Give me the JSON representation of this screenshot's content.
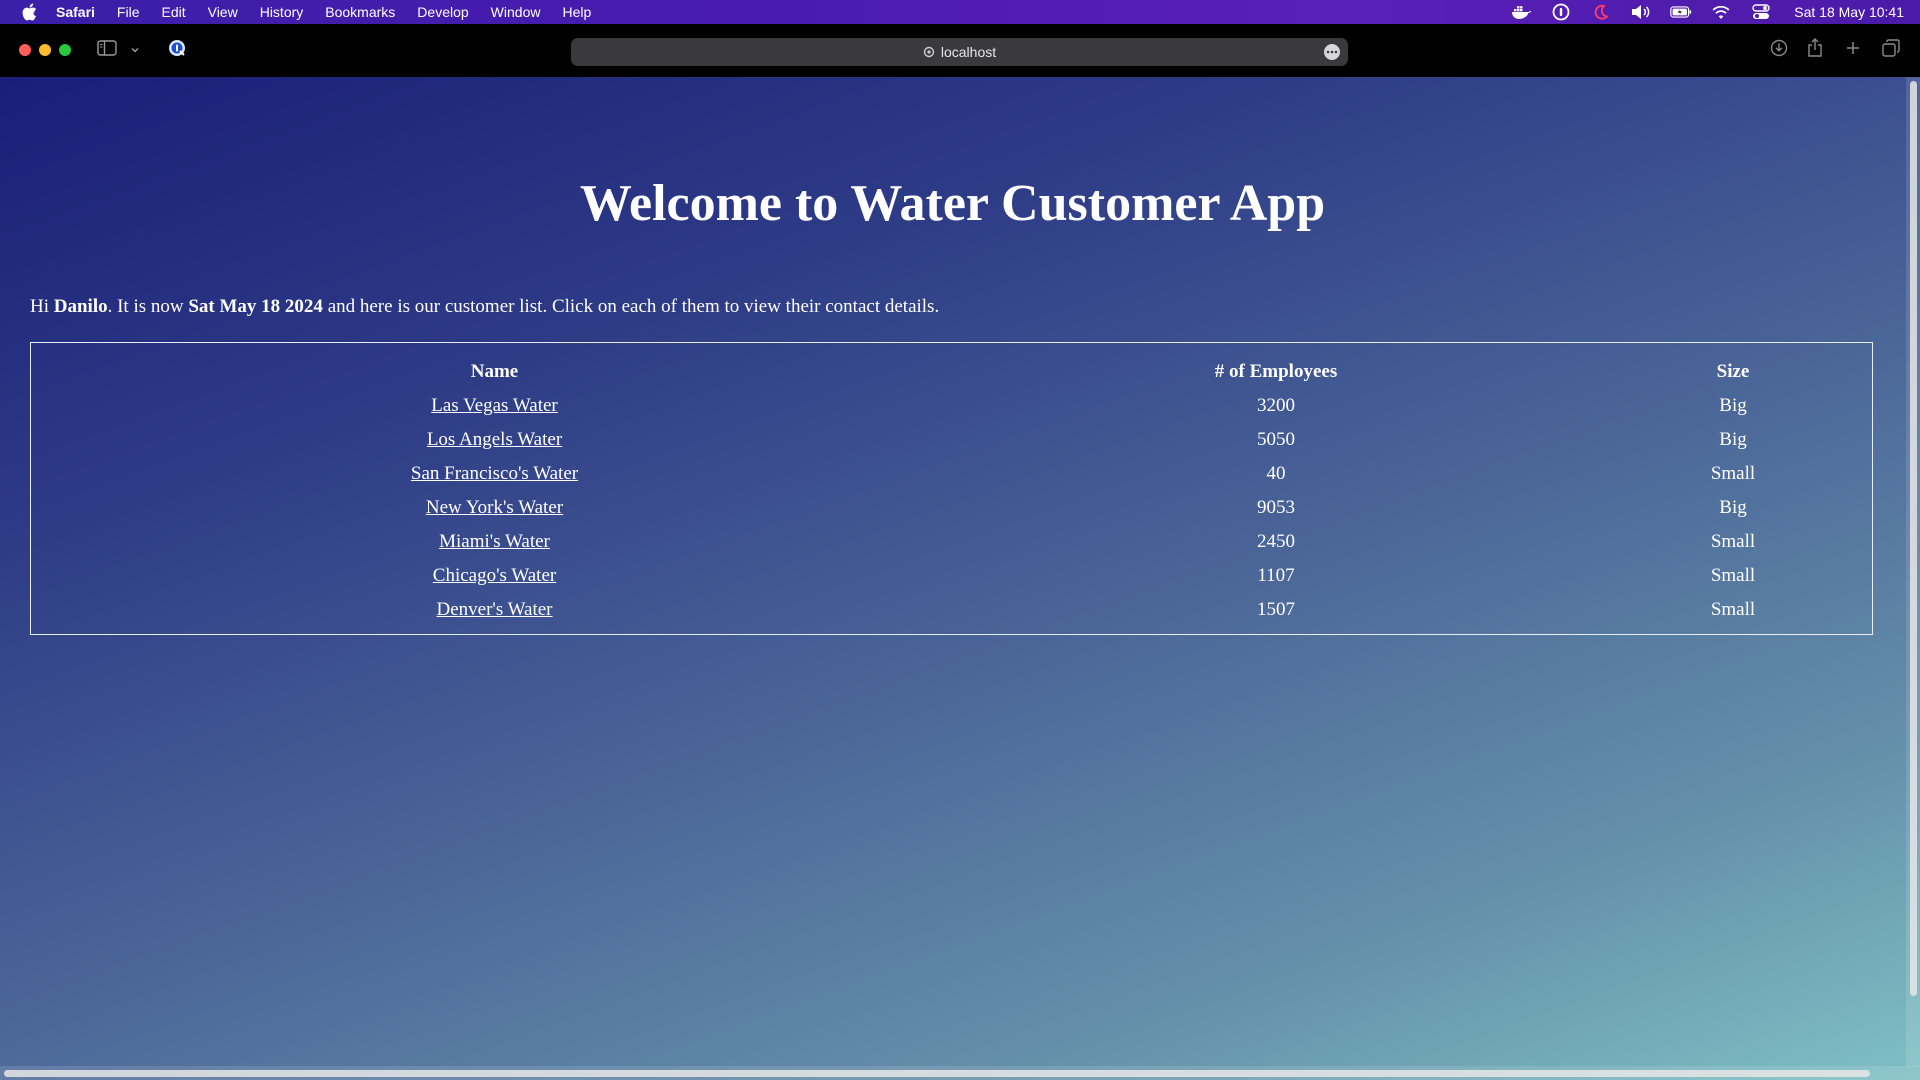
{
  "menubar": {
    "apple_icon": "apple-icon",
    "app_name": "Safari",
    "items": [
      "File",
      "Edit",
      "View",
      "History",
      "Bookmarks",
      "Develop",
      "Window",
      "Help"
    ],
    "status_icons": [
      "docker-icon",
      "password-manager-icon",
      "moon-icon",
      "volume-icon",
      "battery-icon",
      "wifi-icon",
      "control-center-icon"
    ],
    "clock": "Sat 18 May  10:41"
  },
  "toolbar": {
    "address": "localhost",
    "colors": {
      "close": "#ff5f57",
      "minimize": "#febc2e",
      "zoom": "#28c840"
    }
  },
  "page": {
    "title": "Welcome to Water Customer App",
    "intro": {
      "greeting": "Hi ",
      "user": "Danilo",
      "mid": ". It is now ",
      "date": "Sat May 18 2024",
      "rest": " and here is our customer list. Click on each of them to view their contact details."
    },
    "table": {
      "headers": [
        "Name",
        "# of Employees",
        "Size"
      ],
      "rows": [
        [
          "Las Vegas Water",
          "3200",
          "Big"
        ],
        [
          "Los Angels Water",
          "5050",
          "Big"
        ],
        [
          "San Francisco's Water",
          "40",
          "Small"
        ],
        [
          "New York's Water",
          "9053",
          "Big"
        ],
        [
          "Miami's Water",
          "2450",
          "Small"
        ],
        [
          "Chicago's Water",
          "1107",
          "Small"
        ],
        [
          "Denver's Water",
          "1507",
          "Small"
        ]
      ]
    }
  }
}
